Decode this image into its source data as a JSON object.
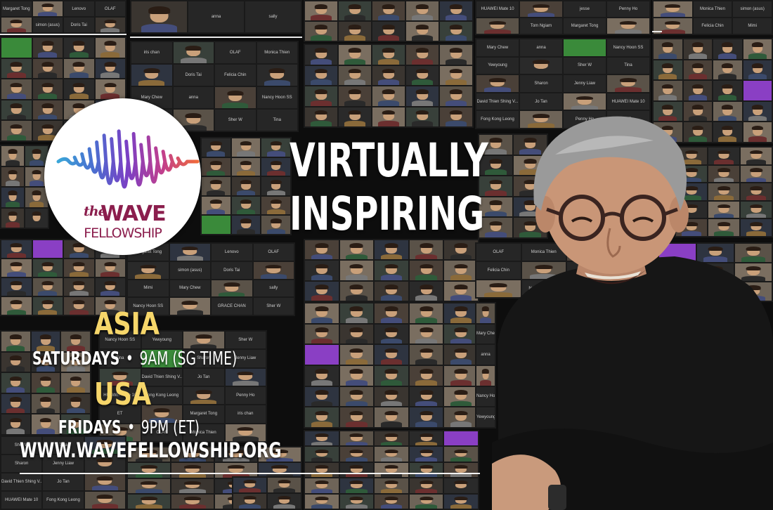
{
  "logo": {
    "the": "the",
    "wave": "WAVE",
    "fellowship": "FELLOWSHIP",
    "colors": [
      "#3aa6d8",
      "#4a6fd0",
      "#7b3fc4",
      "#c23f8c",
      "#f06a3a"
    ]
  },
  "headline": {
    "line1": "VIRTUALLY",
    "line2": "INSPIRING"
  },
  "schedule": {
    "asia": {
      "region": "ASIA",
      "day": "SATURDAYS",
      "dot": "•",
      "time": "9AM (SG TIME)"
    },
    "usa": {
      "region": "USA",
      "day": "FRIDAYS",
      "dot": "•",
      "time": "9PM (ET)"
    }
  },
  "website": "WWW.WAVEFELLOWSHIP.ORG",
  "colors": {
    "region": "#f6d66a",
    "text": "#ffffff",
    "background": "#0d0d0d",
    "logo_text": "#8b1e4d"
  },
  "gallery_names": [
    "Tom Ngiam",
    "Margaret Tong",
    "iris chan",
    "Lenovo",
    "OLAF",
    "Monica Thien",
    "simon (asus)",
    "Doris Tai",
    "Felicia Chin",
    "Mimi",
    "Mary Chew",
    "anna",
    "sally",
    "Nancy Hoon SS",
    "Yewyoung",
    "GRACE CHAN",
    "Sher W",
    "Tina",
    "Anderson Yap",
    "Sharon",
    "Jenny Liaw",
    "Ron Ngiam",
    "David Thien Shing V...",
    "Jo Tan",
    "iPhone",
    "HUAWEI Mate 10",
    "Fong Kong Leong",
    "jesse",
    "Penny Ho",
    "ET"
  ]
}
